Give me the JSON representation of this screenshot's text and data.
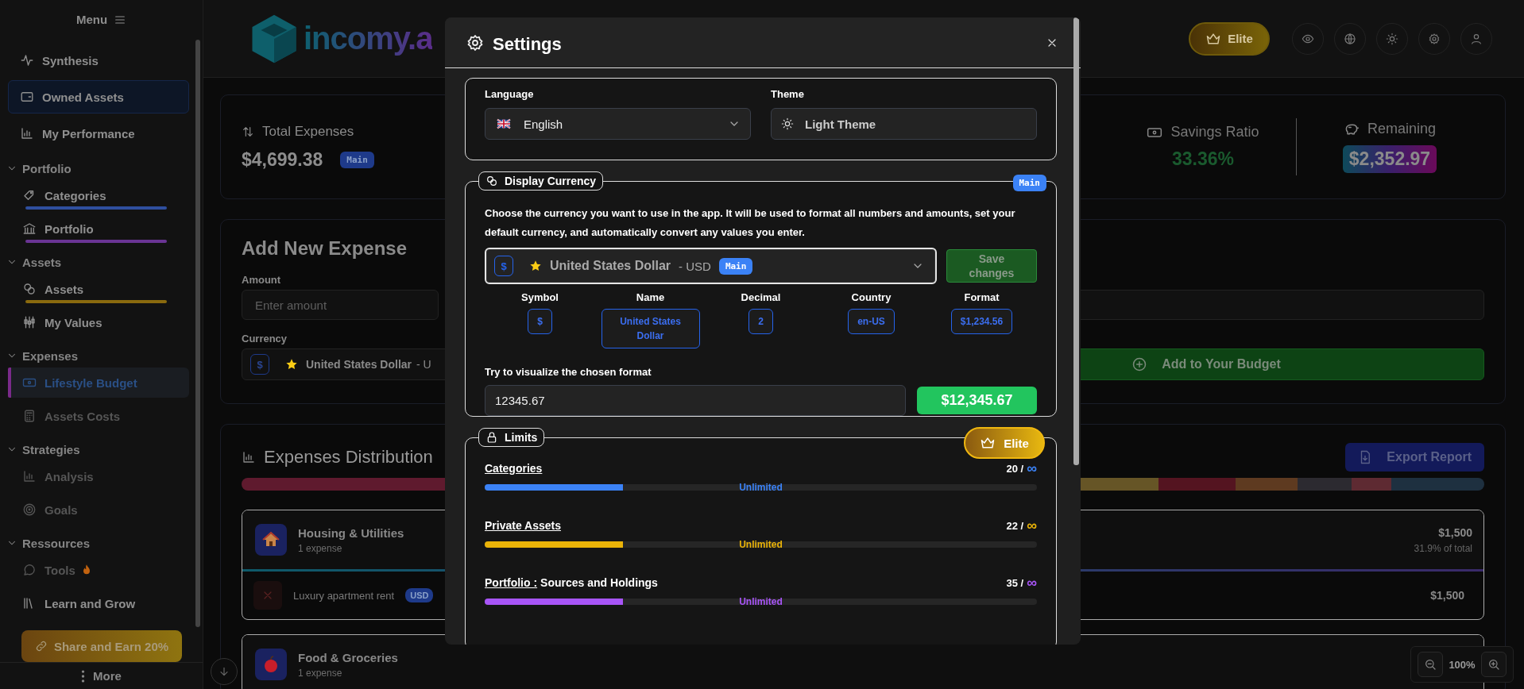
{
  "sidebar": {
    "menu_label": "Menu",
    "top_items": [
      {
        "label": "Synthesis",
        "hovered": false
      },
      {
        "label": "Owned Assets",
        "hovered": true
      },
      {
        "label": "My Performance",
        "hovered": false
      }
    ],
    "sections": [
      {
        "title": "Portfolio",
        "expanded": true,
        "items": [
          {
            "label": "Categories",
            "selected": false,
            "disabled": false,
            "color": "#2f4f9e"
          },
          {
            "label": "Portfolio",
            "selected": false,
            "disabled": false,
            "color": "#6a3494"
          }
        ]
      },
      {
        "title": "Assets",
        "expanded": true,
        "items": [
          {
            "label": "Assets",
            "selected": false,
            "disabled": false,
            "color": "#8a6a0e"
          },
          {
            "label": "My Values",
            "selected": false,
            "disabled": false
          }
        ]
      },
      {
        "title": "Expenses",
        "expanded": true,
        "items": [
          {
            "label": "Lifestyle Budget",
            "selected": true,
            "disabled": false
          },
          {
            "label": "Assets Costs",
            "selected": false,
            "disabled": true
          }
        ]
      },
      {
        "title": "Strategies",
        "expanded": true,
        "items": [
          {
            "label": "Analysis",
            "selected": false,
            "disabled": true
          },
          {
            "label": "Goals",
            "selected": false,
            "disabled": true
          }
        ]
      },
      {
        "title": "Ressources",
        "expanded": true,
        "items": [
          {
            "label": "Tools",
            "selected": false,
            "disabled": true
          },
          {
            "label": "Learn and Grow",
            "selected": false,
            "disabled": false
          }
        ]
      }
    ],
    "share_button": "Share and Earn 20%",
    "more_label": "More"
  },
  "header": {
    "logo_text": "incomy.a",
    "plan_button": "Elite"
  },
  "summary": {
    "total": {
      "label": "Total Expenses",
      "value": "$4,699.38",
      "badge": "Main"
    },
    "savings": {
      "label": "Savings Ratio",
      "value": "33.36%"
    },
    "remaining": {
      "label": "Remaining",
      "value": "$2,352.97"
    }
  },
  "add_expense": {
    "title": "Add New Expense",
    "amount_label": "Amount",
    "amount_placeholder": "Enter amount",
    "currency_label": "Currency",
    "currency_symbol": "$",
    "currency_name": "United States Dollar",
    "currency_code": "- U",
    "add_button": "Add to Your Budget"
  },
  "distribution": {
    "title": "Expenses Distribution",
    "export_button": "Export Report",
    "categories": [
      {
        "name": "Housing & Utilities",
        "count": "1 expense",
        "expanded": true,
        "total": "$1,500",
        "share": "31.9% of total",
        "items": [
          {
            "name": "Luxury apartment rent",
            "currency": "USD",
            "amount": "$1,500"
          }
        ]
      },
      {
        "name": "Food & Groceries",
        "count": "1 expense",
        "expanded": false
      }
    ]
  },
  "zoom": {
    "value": "100%"
  },
  "settings": {
    "title": "Settings",
    "language": {
      "label": "Language",
      "value": "English"
    },
    "theme": {
      "label": "Theme",
      "value": "Light Theme"
    },
    "display_currency": {
      "title": "Display Currency",
      "badge": "Main",
      "description": "Choose the currency you want to use in the app. It will be used to format all numbers and amounts, set your default currency, and automatically convert any values you enter.",
      "select": {
        "symbol": "$",
        "name": "United States Dollar",
        "code": "- USD",
        "badge": "Main"
      },
      "save_button": {
        "label": "Save changes",
        "disabled": true
      },
      "details": [
        {
          "label": "Symbol",
          "value": "$"
        },
        {
          "label": "Name",
          "value": "United States Dollar"
        },
        {
          "label": "Decimal",
          "value": "2"
        },
        {
          "label": "Country",
          "value": "en-US"
        },
        {
          "label": "Format",
          "value": "$1,234.56"
        }
      ],
      "preview": {
        "label": "Try to visualize the chosen format",
        "value": "12345.67",
        "result": "$12,345.67"
      }
    },
    "limits": {
      "title": "Limits",
      "plan_button": "Elite",
      "rows": [
        {
          "name": "Categories",
          "count": "20 /",
          "limit": "∞",
          "level": 0.25,
          "status": "Unlimited",
          "color": "#3b82f6"
        },
        {
          "name": "Private Assets",
          "count": "22 /",
          "limit": "∞",
          "level": 0.25,
          "status": "Unlimited",
          "color": "#eab308"
        },
        {
          "name": "Portfolio :",
          "suffix": "Sources and Holdings",
          "count": "35 /",
          "limit": "∞",
          "level": 0.25,
          "status": "Unlimited",
          "color": "#a855f7"
        }
      ]
    }
  }
}
